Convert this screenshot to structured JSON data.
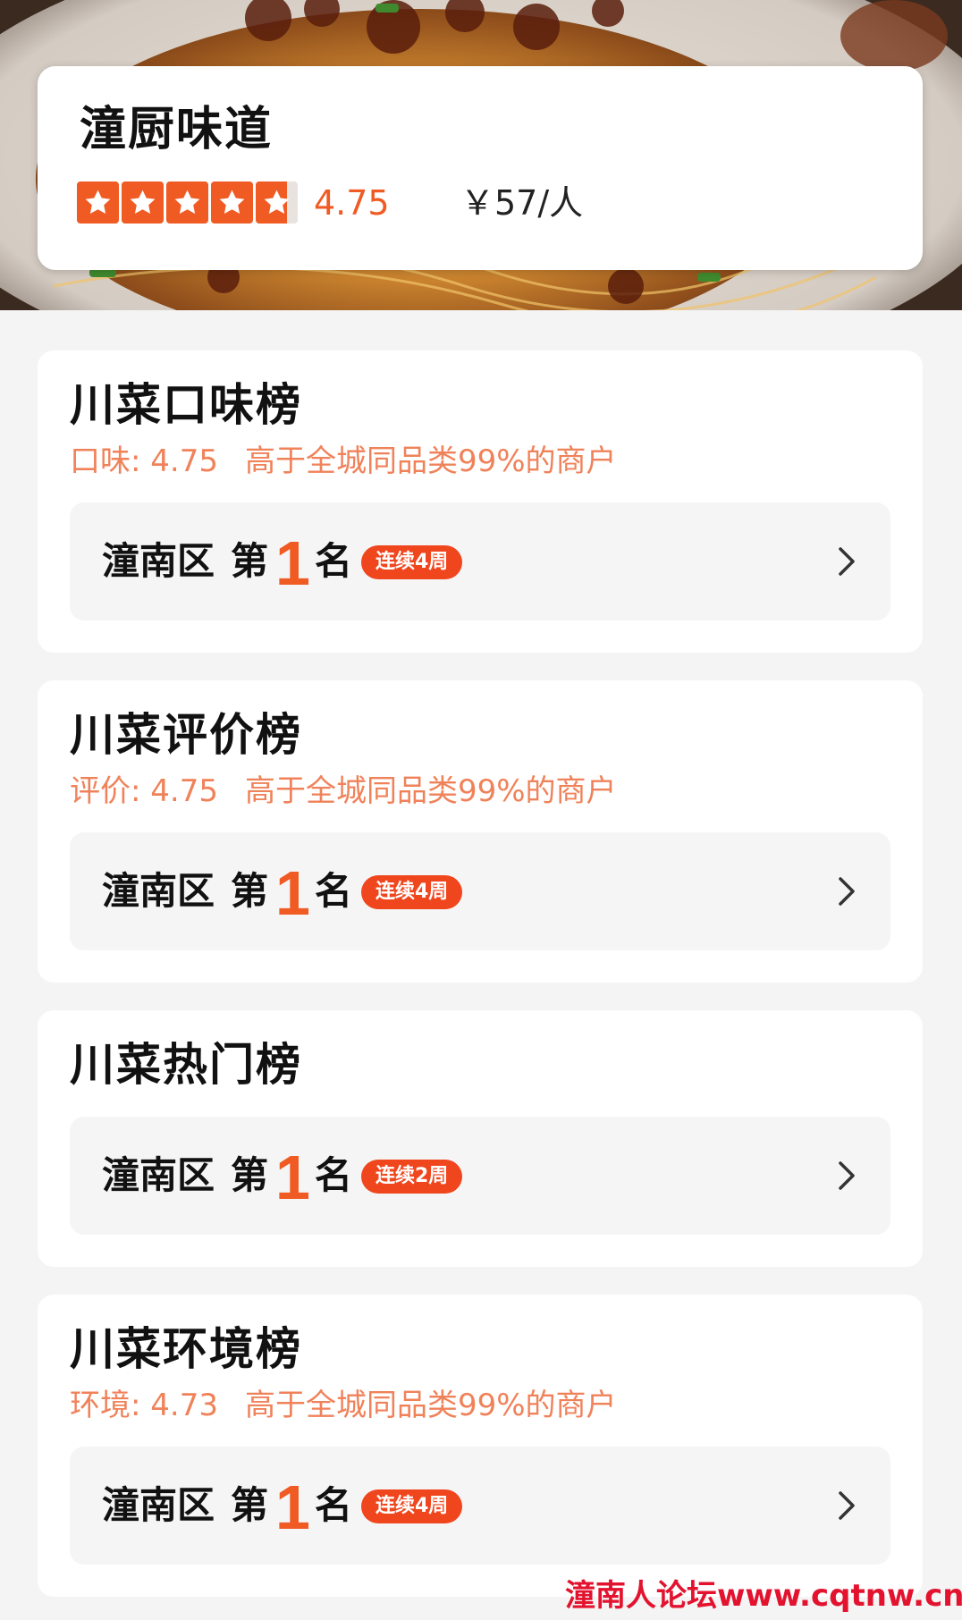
{
  "shop": {
    "name": "潼厨味道",
    "rating_value": 4.75,
    "rating_text": "4.75",
    "price": "￥57/人",
    "stars": 4.75
  },
  "colors": {
    "accent": "#f05a23",
    "sub_text": "#f0825a",
    "badge": "#f0461e",
    "watermark": "#e3132f"
  },
  "icons": {
    "star": "star-icon",
    "chevron": "chevron-right-icon"
  },
  "boards": [
    {
      "title": "川菜口味榜",
      "metric_label": "口味: 4.75",
      "comparison": "高于全城同品类99%的商户",
      "district": "潼南区",
      "di": "第",
      "rank": "1",
      "ming": "名",
      "streak": "连续4周"
    },
    {
      "title": "川菜评价榜",
      "metric_label": "评价: 4.75",
      "comparison": "高于全城同品类99%的商户",
      "district": "潼南区",
      "di": "第",
      "rank": "1",
      "ming": "名",
      "streak": "连续4周"
    },
    {
      "title": "川菜热门榜",
      "district": "潼南区",
      "di": "第",
      "rank": "1",
      "ming": "名",
      "streak": "连续2周"
    },
    {
      "title": "川菜环境榜",
      "metric_label": "环境: 4.73",
      "comparison": "高于全城同品类99%的商户",
      "district": "潼南区",
      "di": "第",
      "rank": "1",
      "ming": "名",
      "streak": "连续4周"
    }
  ],
  "watermark": "潼南人论坛www.cqtnw.cn"
}
